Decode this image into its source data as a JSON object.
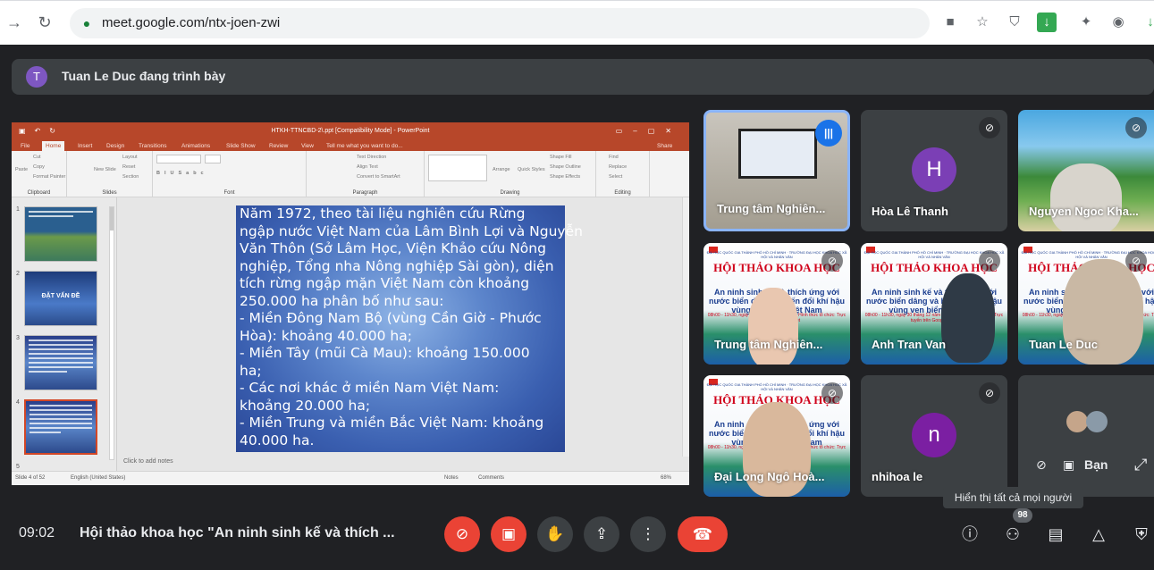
{
  "browser": {
    "url": "meet.google.com/ntx-joen-zwi",
    "icons": [
      "back-icon",
      "reload-icon",
      "lock-icon",
      "camera-icon",
      "star-icon",
      "shield-icon",
      "download-icon",
      "extensions-icon",
      "profile-icon"
    ]
  },
  "presenter": {
    "initial": "T",
    "label": "Tuan Le Duc đang trình bày",
    "avatar_color": "#7e57c2"
  },
  "powerpoint": {
    "title": "HTKH-TTNCBD-2\\.ppt [Compatibility Mode] - PowerPoint",
    "tabs": [
      "File",
      "Home",
      "Insert",
      "Design",
      "Transitions",
      "Animations",
      "Slide Show",
      "Review",
      "View",
      "Tell me what you want to do..."
    ],
    "share": "Share",
    "ribbon": {
      "groups": [
        "Clipboard",
        "Slides",
        "Font",
        "Paragraph",
        "Drawing",
        "Editing"
      ],
      "clipboard": [
        "Paste",
        "Cut",
        "Copy",
        "Format Painter"
      ],
      "slides": [
        "New Slide",
        "Layout",
        "Reset",
        "Section"
      ],
      "paragraph": [
        "Text Direction",
        "Align Text",
        "Convert to SmartArt"
      ],
      "drawing": [
        "Arrange",
        "Quick Styles",
        "Shape Fill",
        "Shape Outline",
        "Shape Effects"
      ],
      "editing": [
        "Find",
        "Replace",
        "Select"
      ]
    },
    "thumbnails": [
      {
        "num": "1",
        "text": ""
      },
      {
        "num": "2",
        "text": "ĐẶT VẤN ĐỀ"
      },
      {
        "num": "3",
        "text": ""
      },
      {
        "num": "4",
        "text": ""
      },
      {
        "num": "5",
        "text": ""
      }
    ],
    "slide_lines": [
      "      Năm 1972, theo tài liệu nghiên cứu Rừng",
      "ngập nước Việt Nam của Lâm Bình Lợi và Nguyễn",
      "Văn Thôn (Sở Lâm Học, Viện Khảo cứu Nông",
      "nghiệp, Tổng nha Nông nghiệp Sài gòn), diện",
      "tích rừng ngập mặn Việt Nam còn khoảng",
      "250.000 ha phân bố như sau:",
      "      - Miền Đông Nam Bộ (vùng Cần Giờ - Phước",
      "Hòa): khoảng 40.000 ha;",
      "      - Miền Tây (mũi Cà Mau): khoảng 150.000",
      "ha;",
      "      - Các nơi khác ở miền Nam Việt Nam:",
      "khoảng 20.000 ha;",
      "      - Miền Trung và miền Bắc Việt Nam: khoảng",
      "40.000 ha."
    ],
    "notes_placeholder": "Click to add notes",
    "status": {
      "slide": "Slide 4 of 52",
      "language": "English (United States)",
      "notes": "Notes",
      "comments": "Comments",
      "zoom": "68%"
    }
  },
  "participants": [
    {
      "name": "Trung tâm Nghiên...",
      "kind": "photo-office",
      "speaking": true
    },
    {
      "name": "Hòa Lê Thanh",
      "kind": "avatar",
      "initial": "H",
      "color": "#7b3fb5"
    },
    {
      "name": "Nguyen Ngoc Kha...",
      "kind": "photo-beach"
    },
    {
      "name": "Trung tâm Nghiên...",
      "kind": "poster"
    },
    {
      "name": "Anh Tran Van",
      "kind": "poster"
    },
    {
      "name": "Tuan Le Duc",
      "kind": "poster"
    },
    {
      "name": "Đại Long Ngô Hoà...",
      "kind": "poster"
    },
    {
      "name": "nhihoa le",
      "kind": "avatar",
      "initial": "n",
      "color": "#7b1fa2"
    }
  ],
  "poster": {
    "head": "ĐẠI HỌC QUỐC GIA THÀNH PHỐ HỒ CHÍ MINH · TRƯỜNG ĐẠI HỌC KHOA HỌC XÃ HỘI VÀ NHÂN VĂN",
    "title": "HỘI THẢO KHOA HỌC",
    "subtitle": "An ninh sinh kế và thích ứng với nước biển dâng và biến đổi khí hậu vùng ven biển Việt Nam",
    "date": "08h00 - 11h30, ngày 30 tháng 12 năm 2021 · Hình thức tổ chức: Trực tuyến trên Google Meet"
  },
  "self": {
    "label": "Bạn"
  },
  "tooltip": "Hiển thị tất cả mọi người",
  "bottom_bar": {
    "time": "09:02",
    "meeting_title": "Hội thảo khoa học \"An ninh sinh kế và thích ...",
    "participant_count": "98"
  },
  "colors": {
    "red": "#ea4335",
    "dark": "#202124",
    "tile": "#3c4043",
    "blue": "#1a73e8",
    "ppt": "#b7472a"
  }
}
